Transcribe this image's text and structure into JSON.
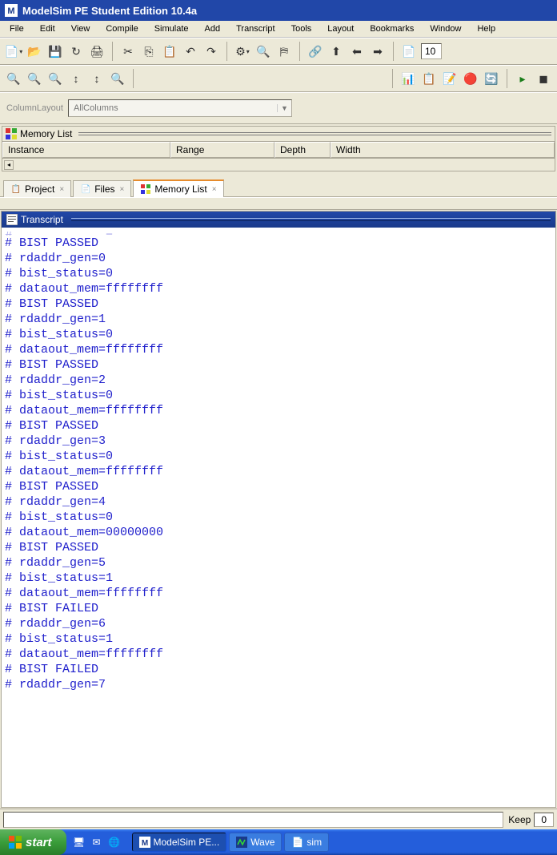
{
  "title": "ModelSim PE Student Edition 10.4a",
  "menu": [
    "File",
    "Edit",
    "View",
    "Compile",
    "Simulate",
    "Add",
    "Transcript",
    "Tools",
    "Layout",
    "Bookmarks",
    "Window",
    "Help"
  ],
  "toolbar1_right_input": "10",
  "column_layout_label": "ColumnLayout",
  "column_layout_value": "AllColumns",
  "memlist_title": "Memory List",
  "memlist_columns": [
    "Instance",
    "Range",
    "Depth",
    "Width"
  ],
  "tabs": [
    {
      "label": "Project",
      "active": false
    },
    {
      "label": "Files",
      "active": false
    },
    {
      "label": "Memory List",
      "active": true
    }
  ],
  "transcript_title": "Transcript",
  "transcript_lines": [
    "# BIST PASSED",
    "# rdaddr_gen=0",
    "# bist_status=0",
    "# dataout_mem=ffffffff",
    "# BIST PASSED",
    "# rdaddr_gen=1",
    "# bist_status=0",
    "# dataout_mem=ffffffff",
    "# BIST PASSED",
    "# rdaddr_gen=2",
    "# bist_status=0",
    "# dataout_mem=ffffffff",
    "# BIST PASSED",
    "# rdaddr_gen=3",
    "# bist_status=0",
    "# dataout_mem=ffffffff",
    "# BIST PASSED",
    "# rdaddr_gen=4",
    "# bist_status=0",
    "# dataout_mem=00000000",
    "# BIST PASSED",
    "# rdaddr_gen=5",
    "# bist_status=1",
    "# dataout_mem=ffffffff",
    "# BIST FAILED",
    "# rdaddr_gen=6",
    "# bist_status=1",
    "# dataout_mem=ffffffff",
    "# BIST FAILED",
    "# rdaddr_gen=7"
  ],
  "keep_label": "Keep",
  "keep_value": "0",
  "start_label": "start",
  "task_items": [
    {
      "label": "ModelSim PE...",
      "active": true
    },
    {
      "label": "Wave",
      "active": false
    },
    {
      "label": "sim",
      "active": false
    }
  ]
}
